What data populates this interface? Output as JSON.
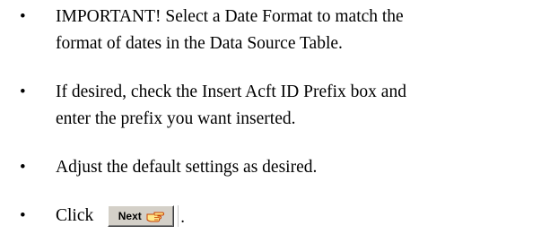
{
  "instructions": [
    {
      "bullet": "•",
      "lines": [
        "IMPORTANT! Select a Date Format to match the",
        "format of dates in the Data Source Table."
      ]
    },
    {
      "bullet": "•",
      "lines": [
        "If desired, check the Insert Acft ID Prefix box and",
        "enter the prefix you want inserted."
      ]
    },
    {
      "bullet": "•",
      "lines": [
        "Adjust the default settings as desired."
      ]
    },
    {
      "bullet": "•",
      "prefix": "Click",
      "suffix": "."
    }
  ],
  "next_button": {
    "label": "Next",
    "icon": "pointing-hand-icon",
    "face_color": "#d4d0c8"
  }
}
